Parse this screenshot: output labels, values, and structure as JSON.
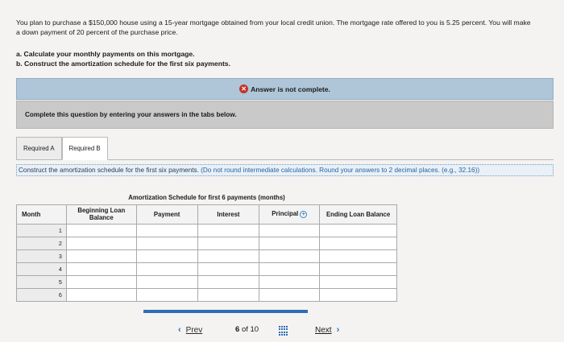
{
  "question": {
    "text": "You plan to purchase a $150,000 house using a 15-year mortgage obtained from your local credit union. The mortgage rate offered to you is 5.25 percent. You will make a down payment of 20 percent of the purchase price.",
    "task_a": "a. Calculate your monthly payments on this mortgage.",
    "task_b": "b. Construct the amortization schedule for the first six payments."
  },
  "alert": {
    "icon": "x-circle-icon",
    "text": "Answer is not complete."
  },
  "instruction": "Complete this question by entering your answers in the tabs below.",
  "tabs": [
    {
      "label": "Required A",
      "active": false
    },
    {
      "label": "Required B",
      "active": true
    }
  ],
  "hint": {
    "text": "Construct the amortization schedule for the first six payments. ",
    "note": "(Do not round intermediate calculations. Round your answers to 2 decimal places. (e.g., 32.16))"
  },
  "schedule": {
    "caption": "Amortization Schedule for first 6 payments (months)",
    "headers": {
      "month": "Month",
      "beginning": "Beginning Loan Balance",
      "payment": "Payment",
      "interest": "Interest",
      "principal": "Principal",
      "ending": "Ending Loan Balance"
    },
    "months": [
      "1",
      "2",
      "3",
      "4",
      "5",
      "6"
    ]
  },
  "pager": {
    "prev": "Prev",
    "current": "6",
    "of": "of",
    "total": "10",
    "next": "Next"
  },
  "colors": {
    "alert_bar": "#aec6d8",
    "instruction_bar": "#c9c9c9",
    "accent_blue": "#2f6db5",
    "error_red": "#c8322b"
  }
}
